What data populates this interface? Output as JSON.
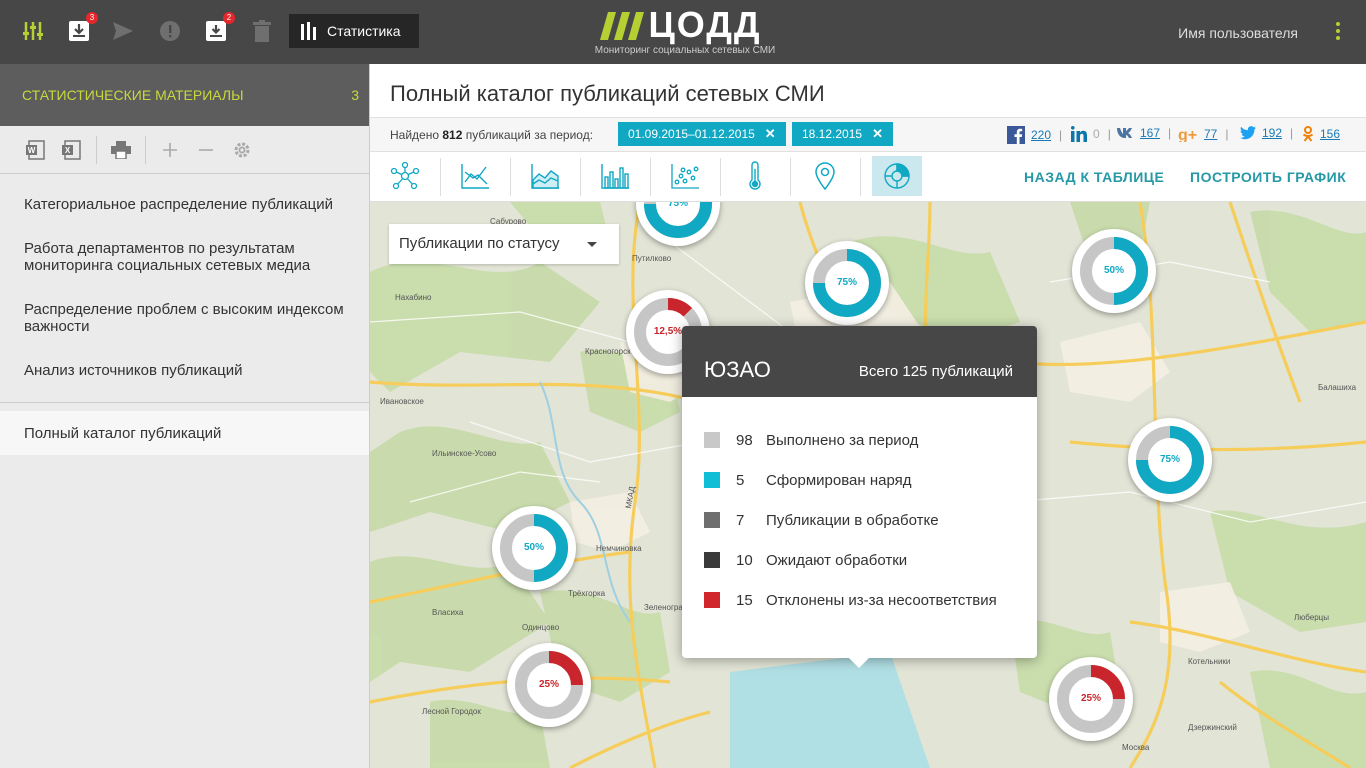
{
  "topbar": {
    "stats_label": "Статистика",
    "badge_inbox": "3",
    "badge_archive": "2",
    "logo_text": "ЦОДД",
    "logo_subtitle": "Мониторинг социальных сетевых СМИ",
    "username": "Имя пользователя",
    "accent": "#b6cf32"
  },
  "sidebar": {
    "header_title": "СТАТИСТИЧЕСКИЕ МАТЕРИАЛЫ",
    "header_count": "3",
    "items": [
      {
        "label": "Категориальное распределение публикаций"
      },
      {
        "label": "Работа департаментов по результатам мониторинга социальных сетевых медиа"
      },
      {
        "label": "Распределение проблем с высоким индексом важности"
      },
      {
        "label": "Анализ источников публикаций"
      }
    ],
    "active_item": "Полный каталог публикаций"
  },
  "main": {
    "title": "Полный каталог публикаций сетевых СМИ",
    "found_prefix": "Найдено",
    "found_count": "812",
    "found_suffix": "публикаций за период:",
    "chips": [
      "01.09.2015–01.12.2015",
      "18.12.2015"
    ],
    "social": [
      {
        "icon": "facebook-icon",
        "count": "220"
      },
      {
        "icon": "linkedin-icon",
        "count": "0"
      },
      {
        "icon": "vk-icon",
        "count": "167"
      },
      {
        "icon": "google-plus-icon",
        "count": "77"
      },
      {
        "icon": "twitter-icon",
        "count": "192"
      },
      {
        "icon": "odnoklassniki-icon",
        "count": "156"
      }
    ],
    "back_link": "НАЗАД К ТАБЛИЦЕ",
    "build_link": "ПОСТРОИТЬ ГРАФИК"
  },
  "map": {
    "select_value": "Публикации по статусу",
    "donuts": [
      {
        "label": "75%",
        "fraction": 0.75,
        "color": "#10a8c3"
      },
      {
        "label": "75%",
        "fraction": 0.75,
        "color": "#10a8c3"
      },
      {
        "label": "50%",
        "fraction": 0.5,
        "color": "#10a8c3"
      },
      {
        "label": "12,5%",
        "fraction": 0.125,
        "color": "#c8262c"
      },
      {
        "label": "75%",
        "fraction": 0.75,
        "color": "#10a8c3"
      },
      {
        "label": "50%",
        "fraction": 0.5,
        "color": "#10a8c3"
      },
      {
        "label": "25%",
        "fraction": 0.25,
        "color": "#c8262c"
      },
      {
        "label": "25%",
        "fraction": 0.25,
        "color": "#c8262c"
      }
    ],
    "labels": [
      "Сабурово",
      "Путилково",
      "Красногорск",
      "Нахабино",
      "Ивановское",
      "Ильинское-Усово",
      "Одинцово",
      "Власиха",
      "Немчиновка",
      "Трёхгорка",
      "Зеленоград",
      "Лесной Городок",
      "МКАД",
      "Балашиха",
      "Люберцы",
      "Котельники",
      "Дзержинский",
      "Москва"
    ]
  },
  "popup": {
    "title": "ЮЗАО",
    "total": "Всего 125 публикаций",
    "legend": [
      {
        "count": "98",
        "label": "Выполнено за период",
        "color": "#c8c8c8"
      },
      {
        "count": "5",
        "label": "Сформирован наряд",
        "color": "#10bed6"
      },
      {
        "count": "7",
        "label": "Публикации в обработке",
        "color": "#6e6e6e"
      },
      {
        "count": "10",
        "label": "Ожидают обработки",
        "color": "#3a3a3a"
      },
      {
        "count": "15",
        "label": "Отклонены из-за несоответствия",
        "color": "#d0262c"
      }
    ]
  }
}
